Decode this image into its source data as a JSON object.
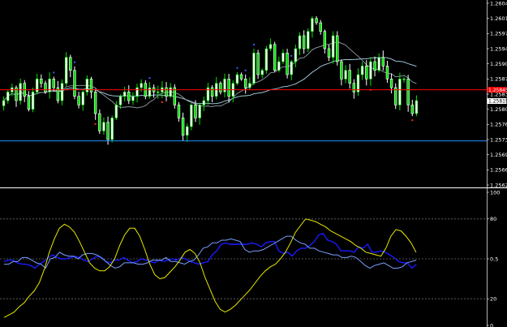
{
  "colors": {
    "background": "#000000",
    "grid": "#6b6b6b",
    "bull_candle": "#00e000",
    "bear_candle": "#ffffff",
    "fractal_up": "#3b5bff",
    "fractal_down": "#ff2a2a",
    "ma_fast": "#8fa0a8",
    "ma_slow": "#a8d8e8",
    "resistance_line": "#ff0000",
    "support_line": "#1e90ff",
    "osc_blue": "#1a1aff",
    "osc_lightblue": "#7aa0ff",
    "osc_yellow": "#e8e800",
    "axis_text": "#ffffff",
    "current_price_bg": "#ffffff",
    "red_tag_bg": "#ff0000"
  },
  "chart_data": [
    {
      "type": "candlestick",
      "panel": "price",
      "ylim": [
        1.25625,
        1.26045
      ],
      "y_ticks": [
        "1.26045",
        "1.26010",
        "1.25975",
        "1.25940",
        "1.25905",
        "1.25870",
        "1.25835",
        "1.25800",
        "1.25765",
        "1.25730",
        "1.25695",
        "1.25660",
        "1.25625"
      ],
      "current_price_label": "1.25819",
      "resistance_tag": "1.25845",
      "resistance_level": 1.25845,
      "support_level": 1.25727,
      "grid": false,
      "close": [
        1.2582,
        1.2584,
        1.2585,
        1.2582,
        1.2586,
        1.2583,
        1.258,
        1.2584,
        1.2587,
        1.2586,
        1.2584,
        1.2587,
        1.2585,
        1.2582,
        1.2586,
        1.2592,
        1.2589,
        1.2583,
        1.2581,
        1.2584,
        1.2587,
        1.2584,
        1.2579,
        1.2575,
        1.2577,
        1.2573,
        1.2578,
        1.2581,
        1.2583,
        1.2584,
        1.2582,
        1.2583,
        1.2585,
        1.2586,
        1.2583,
        1.2585,
        1.2584,
        1.2584,
        1.2585,
        1.2583,
        1.2585,
        1.2581,
        1.2578,
        1.2574,
        1.2576,
        1.2581,
        1.2578,
        1.2581,
        1.2582,
        1.2585,
        1.2583,
        1.2586,
        1.2584,
        1.2587,
        1.2583,
        1.2586,
        1.2588,
        1.2587,
        1.2585,
        1.2586,
        1.2593,
        1.2588,
        1.2589,
        1.2594,
        1.2595,
        1.2589,
        1.2591,
        1.2593,
        1.2588,
        1.2591,
        1.2594,
        1.2597,
        1.2594,
        1.2598,
        1.2601,
        1.26,
        1.2598,
        1.2594,
        1.2592,
        1.2597,
        1.2591,
        1.2587,
        1.2589,
        1.2586,
        1.2584,
        1.2588,
        1.259,
        1.2587,
        1.2591,
        1.2589,
        1.2592,
        1.259,
        1.2587,
        1.2585,
        1.2581,
        1.2587,
        1.2587,
        1.2581,
        1.2579,
        1.2582
      ],
      "fractals_up_index": [
        12,
        17,
        35,
        56,
        58,
        60,
        69
      ],
      "fractals_down_index": [
        22,
        38,
        88,
        98
      ]
    },
    {
      "type": "line",
      "panel": "oscillator",
      "ylim": [
        0,
        100
      ],
      "y_ticks": [
        "100",
        "80",
        "0.5",
        "20",
        "0"
      ],
      "levels": [
        80,
        50,
        20
      ],
      "grid": true,
      "series": [
        {
          "color": "#1a1aff",
          "values": [
            48,
            49,
            49,
            47,
            46,
            46,
            45,
            43,
            46,
            48,
            51,
            53,
            51,
            50,
            50,
            51,
            52,
            51,
            49,
            48,
            50,
            52,
            51,
            48,
            47,
            49,
            49,
            51,
            49,
            47,
            48,
            50,
            49,
            48,
            47,
            49,
            48,
            49,
            50,
            49,
            51,
            50,
            48,
            47,
            46,
            47,
            48,
            53,
            56,
            61,
            62,
            61,
            61,
            61,
            61,
            61,
            62,
            61,
            59,
            62,
            63,
            63,
            56,
            54,
            55,
            52,
            56,
            58,
            58,
            60,
            63,
            68,
            69,
            64,
            63,
            61,
            56,
            56,
            56,
            55,
            59,
            58,
            61,
            55,
            55,
            56,
            55,
            53,
            51,
            48,
            47,
            47,
            43,
            46
          ]
        },
        {
          "color": "#7aa0ff",
          "values": [
            46,
            46,
            48,
            48,
            51,
            51,
            49,
            47,
            46,
            43,
            50,
            51,
            55,
            53,
            52,
            52,
            50,
            53,
            54,
            54,
            53,
            51,
            48,
            45,
            43,
            44,
            47,
            47,
            47,
            46,
            46,
            47,
            49,
            49,
            49,
            51,
            48,
            48,
            47,
            46,
            48,
            49,
            53,
            58,
            59,
            62,
            62,
            64,
            64,
            65,
            64,
            63,
            57,
            55,
            56,
            56,
            57,
            59,
            61,
            63,
            65,
            67,
            67,
            64,
            62,
            61,
            58,
            58,
            56,
            55,
            54,
            53,
            53,
            51,
            51,
            52,
            51,
            48,
            45,
            43,
            45,
            46,
            47,
            45,
            43,
            43,
            44,
            47,
            48,
            49
          ]
        },
        {
          "color": "#e8e800",
          "values": [
            6,
            8,
            10,
            14,
            17,
            22,
            26,
            32,
            42,
            55,
            65,
            73,
            76,
            74,
            70,
            63,
            55,
            47,
            43,
            41,
            41,
            44,
            50,
            60,
            68,
            73,
            73,
            67,
            57,
            46,
            38,
            35,
            36,
            40,
            44,
            49,
            55,
            57,
            54,
            47,
            36,
            27,
            18,
            12,
            10,
            12,
            15,
            19,
            23,
            27,
            32,
            37,
            41,
            44,
            46,
            50,
            55,
            62,
            70,
            75,
            80,
            79,
            78,
            76,
            74,
            71,
            69,
            67,
            65,
            63,
            60,
            58,
            55,
            54,
            53,
            52,
            58,
            67,
            72,
            71,
            67,
            62,
            55
          ]
        }
      ]
    }
  ]
}
